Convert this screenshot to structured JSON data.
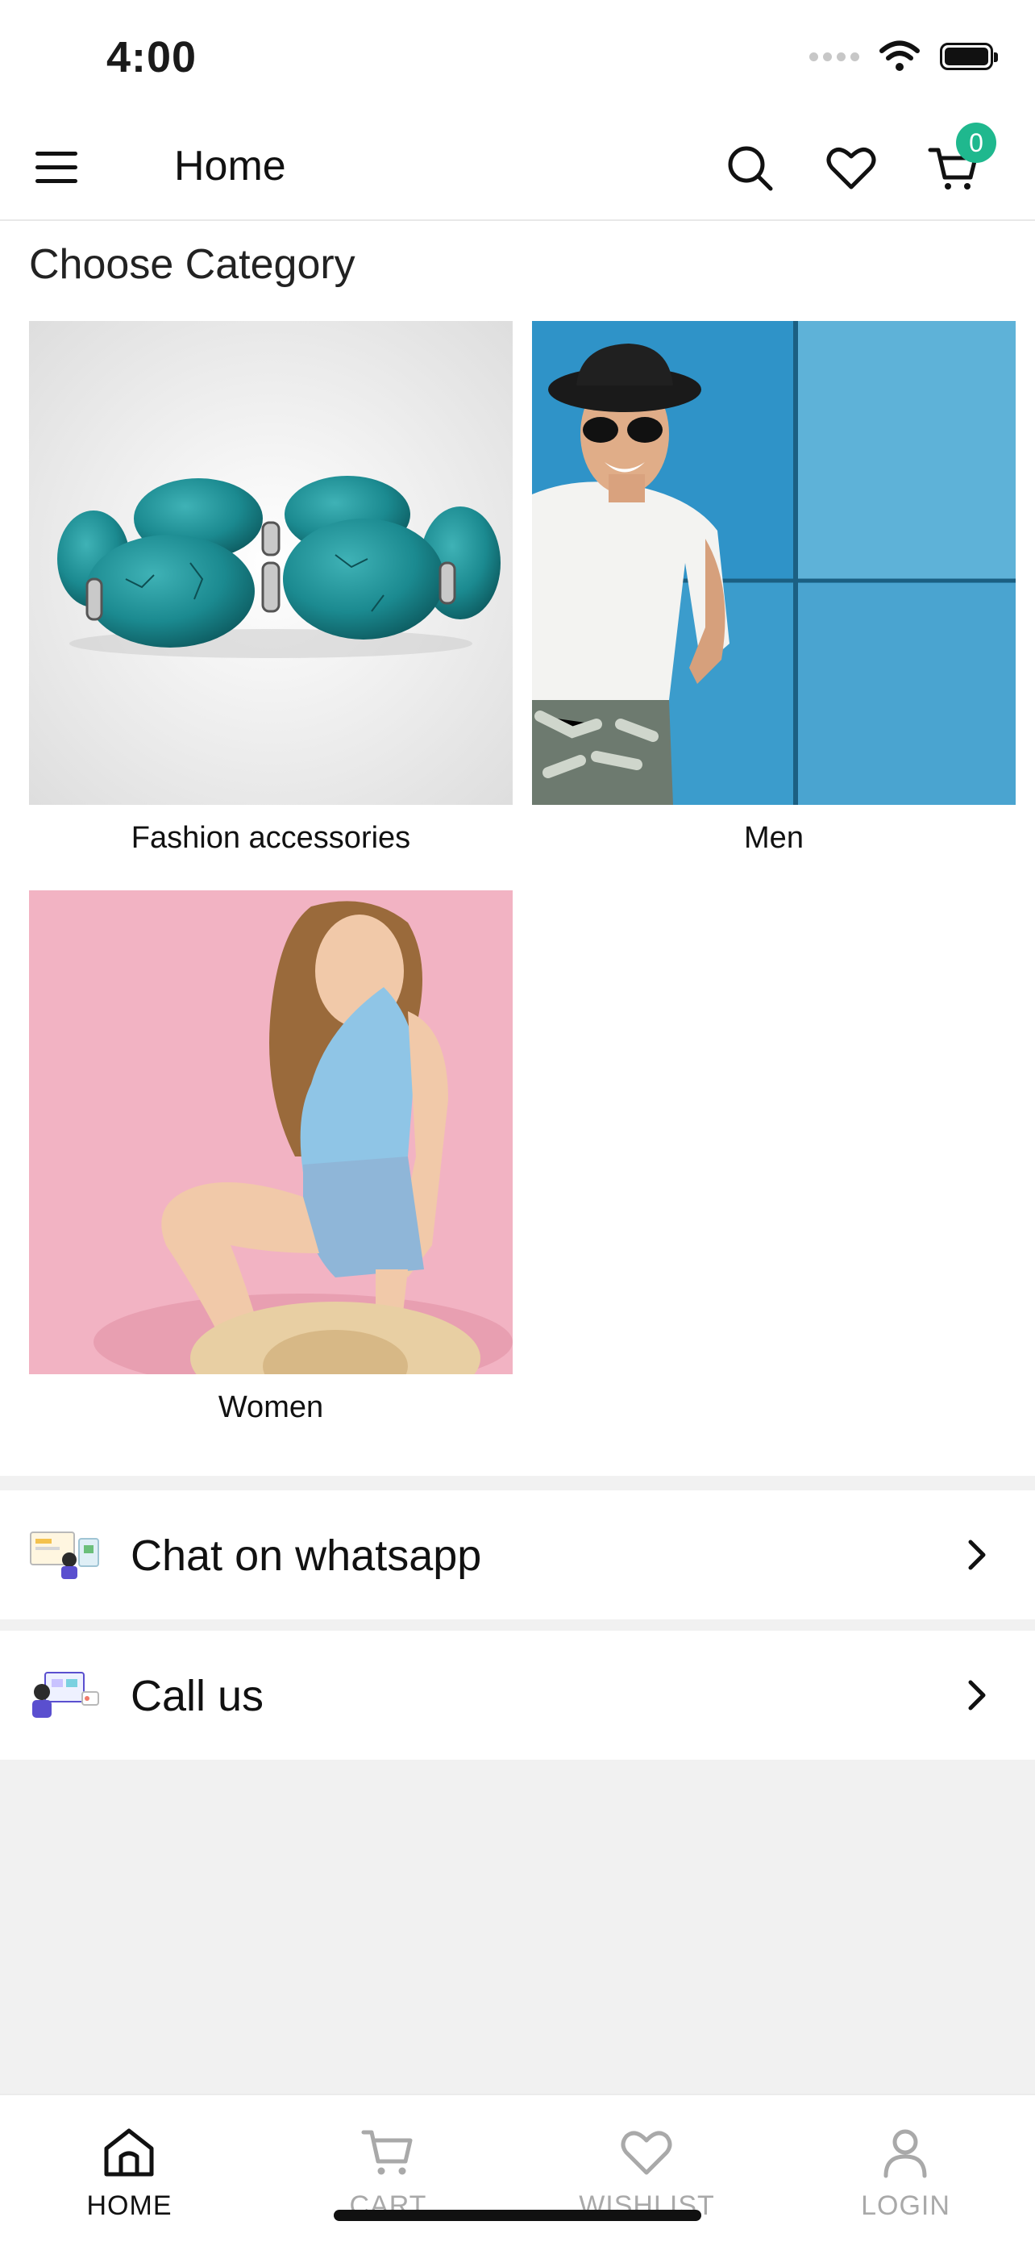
{
  "status_bar": {
    "time": "4:00"
  },
  "app_bar": {
    "title": "Home",
    "cart_count": "0"
  },
  "categories": {
    "heading": "Choose Category",
    "items": [
      {
        "label": "Fashion accessories",
        "image": "turquoise-bracelet-photo"
      },
      {
        "label": "Men",
        "image": "man-white-tshirt-blue-wall-photo"
      },
      {
        "label": "Women",
        "image": "woman-pink-background-photo"
      }
    ]
  },
  "contact": {
    "items": [
      {
        "label": "Chat on whatsapp",
        "icon": "chat-illustration-icon"
      },
      {
        "label": "Call us",
        "icon": "call-illustration-icon"
      }
    ]
  },
  "bottom_nav": {
    "items": [
      {
        "label": "HOME",
        "icon": "home-icon",
        "active": true
      },
      {
        "label": "CART",
        "icon": "cart-icon",
        "active": false
      },
      {
        "label": "WISHLIST",
        "icon": "heart-icon",
        "active": false
      },
      {
        "label": "LOGIN",
        "icon": "user-icon",
        "active": false
      }
    ]
  },
  "colors": {
    "accent": "#1fb88e",
    "background": "#f1f1f1",
    "inactive": "#a9a9a9"
  }
}
